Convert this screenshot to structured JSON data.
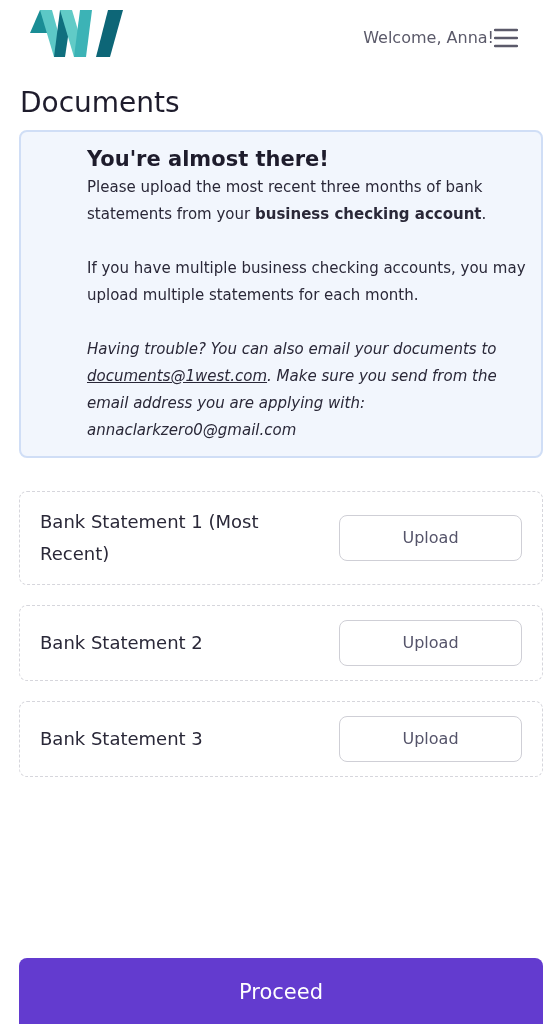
{
  "header": {
    "greeting": "Welcome, Anna!"
  },
  "page_title": "Documents",
  "notice": {
    "heading": "You're almost there!",
    "paragraphs": [
      "Please upload the most recent three months of bank statements from your **business checking account**.",
      "If you have multiple business checking accounts, you may upload multiple statements for each month."
    ],
    "help": {
      "before": "Having trouble? You can also email your documents to ",
      "link": "documents@1west.com",
      "after": ". Make sure you send from the email address you are applying with: annaclarkzero0@gmail.com"
    }
  },
  "statements": [
    {
      "label": "Bank Statement 1 (Most Recent)",
      "button": "Upload"
    },
    {
      "label": "Bank Statement 2",
      "button": "Upload"
    },
    {
      "label": "Bank Statement 3",
      "button": "Upload"
    }
  ],
  "footer": {
    "button": "Proceed"
  }
}
